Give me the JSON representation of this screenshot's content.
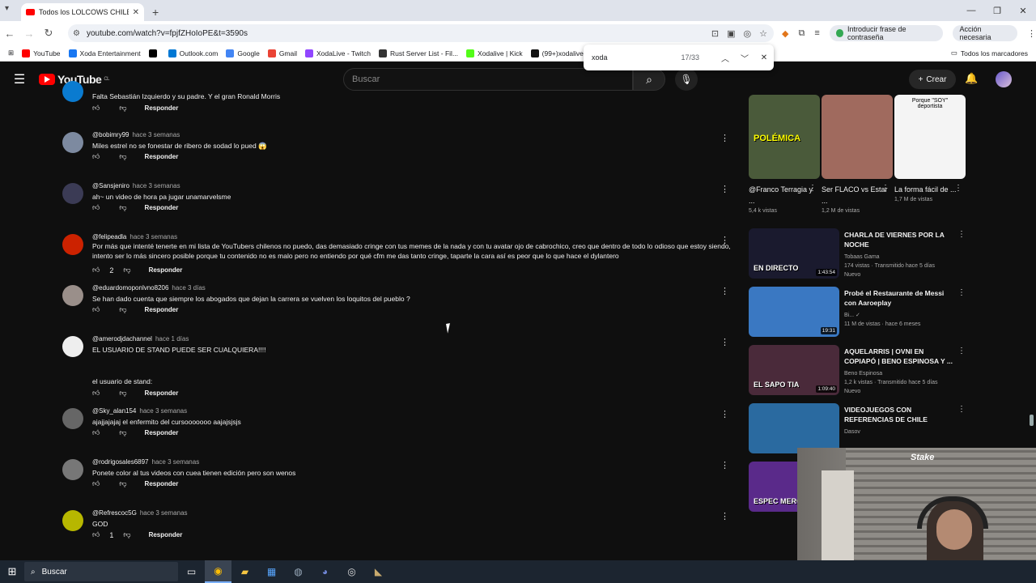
{
  "browser": {
    "tab_title": "Todos los LOLCOWS CHILENOS",
    "url": "youtube.com/watch?v=fpjfZHoIoPE&t=3590s",
    "password_hint": "Introducir frase de contraseña",
    "action_needed": "Acción necesaria",
    "bookmarks": [
      {
        "label": "YouTube",
        "color": "#ff0000"
      },
      {
        "label": "Xoda Entertainment",
        "color": "#1877f2"
      },
      {
        "label": "",
        "color": "#000000"
      },
      {
        "label": "Outlook.com",
        "color": "#0078d4"
      },
      {
        "label": "Google",
        "color": "#4285f4"
      },
      {
        "label": "Gmail",
        "color": "#ea4335"
      },
      {
        "label": "XodaLive - Twitch",
        "color": "#9146ff"
      },
      {
        "label": "Rust Server List - Fil...",
        "color": "#333333"
      },
      {
        "label": "Xodalive | Kick",
        "color": "#53fc18"
      },
      {
        "label": "(99+)xodalive (",
        "color": "#111111"
      }
    ],
    "all_bookmarks": "Todos los marcadores",
    "find": {
      "query": "xoda",
      "count": "17/33"
    }
  },
  "youtube": {
    "logo": "YouTube",
    "region": "CL",
    "search_placeholder": "Buscar",
    "create_label": "Crear"
  },
  "comments": [
    {
      "user": "",
      "meta": "",
      "text": "Falta Sebastián Izquierdo y su padre. Y el gran Ronald Morris",
      "likes": "",
      "reply": "Responder",
      "avatar": "#0a7bd0",
      "partial": true
    },
    {
      "user": "@bobimry99",
      "meta": "hace 3 semanas",
      "text": "Miles estrel no se fonestar de ribero de sodad lo pued 😱",
      "likes": "",
      "reply": "Responder",
      "avatar": "#7d8aa0"
    },
    {
      "user": "@Sansjeniro",
      "meta": "hace 3 semanas",
      "text": "ah~ un video de hora pa jugar unamarvelsme",
      "likes": "",
      "reply": "Responder",
      "avatar": "#3b3b55"
    },
    {
      "user": "@felipeadla",
      "meta": "hace 3 semanas",
      "text": "Por más que intenté tenerte en mi lista de YouTubers chilenos no puedo, das demasiado cringe con tus memes de la nada y con tu avatar ojo de cabrochico, creo que dentro de todo lo odioso que estoy siendo, intento ser lo más sincero posible porque tu contenido no es malo pero no entiendo por qué cfm me das tanto cringe, taparte la cara así es peor que lo que hace el dylantero",
      "likes": "2",
      "reply": "Responder",
      "avatar": "#cc2200"
    },
    {
      "user": "@eduardomoponlvno8206",
      "meta": "hace 3 días",
      "text": "Se han dado cuenta que siempre los abogados que dejan la carrera se vuelven los loquitos del pueblo ?",
      "likes": "",
      "reply": "Responder",
      "avatar": "#9a8f8a"
    },
    {
      "user": "@amerodjdachannel",
      "meta": "hace 1 días",
      "text": "EL USUARIO DE STAND PUEDE SER CUALQUIERA!!!!",
      "text2": "el usuario de stand:",
      "likes": "",
      "reply": "Responder",
      "avatar": "#eeeeee"
    },
    {
      "user": "@Sky_alan154",
      "meta": "hace 3 semanas",
      "text": "ajajjajajaj el  enfermito del cursooooooo aajajsjsjs",
      "likes": "",
      "reply": "Responder",
      "avatar": "#666666"
    },
    {
      "user": "@rodrigosales6897",
      "meta": "hace 3 semanas",
      "text": "Ponete color al tus videos con cuea tienen edición pero son wenos",
      "likes": "",
      "reply": "Responder",
      "avatar": "#777777"
    },
    {
      "user": "@Refrescoc5G",
      "meta": "hace 3 semanas",
      "text": "GOD",
      "likes": "1",
      "reply": "Responder",
      "avatar": "#b7b700"
    }
  ],
  "shorts": [
    {
      "title": "@Franco Terragia y ...",
      "views": "5,4 k vistas",
      "overlay": "POLÉMICA",
      "bg": "#4a5a3a"
    },
    {
      "title": "Ser FLACO vs Estar ...",
      "views": "1,2 M de vistas",
      "overlay": "",
      "bg": "#a06a5e"
    },
    {
      "title": "La forma fácil de ...",
      "views": "1,7 M de vistas",
      "overlay": "Porque \"SOY\" deportista",
      "bg": "#f4f4f4"
    }
  ],
  "videos": [
    {
      "title": "CHARLA DE VIERNES POR LA NOCHE",
      "channel": "Tobaas Gama",
      "meta": "174 vistas · Transmitido hace 5 días",
      "badge": "Nuevo",
      "duration": "1:43:54",
      "overlay": "EN DIRECTO",
      "bg": "#1a1a2e"
    },
    {
      "title": "Probé el Restaurante de Messi con Aaroeplay",
      "channel": "Bi... ✓",
      "meta": "11 M de vistas · hace 6 meses",
      "badge": "",
      "duration": "19:31",
      "overlay": "",
      "bg": "#3a78c2"
    },
    {
      "title": "AQUELARRIS | OVNI EN COPIAPÓ | BENO ESPINOSA Y ...",
      "channel": "Beno Espinosa",
      "meta": "1,2 k vistas · Transmitido hace 5 días",
      "badge": "Nuevo",
      "duration": "1:09:40",
      "overlay": "EL SAPO TIA",
      "bg": "#4a2a3a"
    },
    {
      "title": "VIDEOJUEGOS CON REFERENCIAS DE CHILE",
      "channel": "Dasov",
      "meta": "",
      "badge": "",
      "duration": "",
      "overlay": "",
      "bg": "#2a6aa0"
    },
    {
      "title": "",
      "channel": "",
      "meta": "",
      "badge": "",
      "duration": "",
      "overlay": "ESPEC MERC",
      "bg": "#5a2a8a"
    }
  ],
  "webcam": {
    "brand": "Stake"
  },
  "taskbar": {
    "search": "Buscar"
  }
}
